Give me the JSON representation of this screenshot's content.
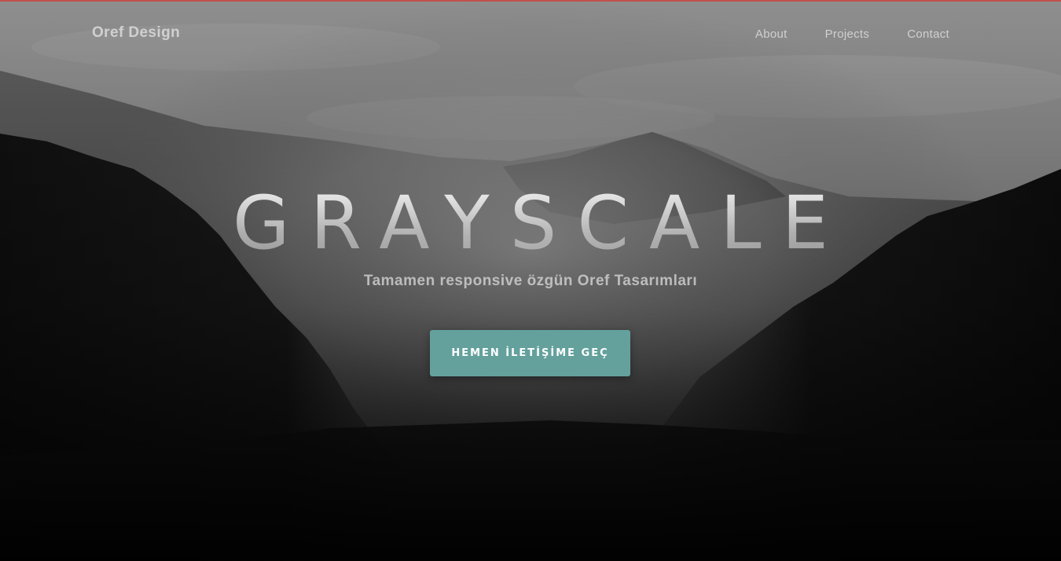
{
  "nav": {
    "brand": "Oref Design",
    "links": [
      "About",
      "Projects",
      "Contact"
    ]
  },
  "hero": {
    "title": "GRAYSCALE",
    "subtitle": "Tamamen responsive özgün Oref Tasarımları",
    "button_label": "HEMEN İLETİŞİME GEÇ"
  },
  "colors": {
    "accent": "#64a19d",
    "top_border": "#c0504d"
  }
}
